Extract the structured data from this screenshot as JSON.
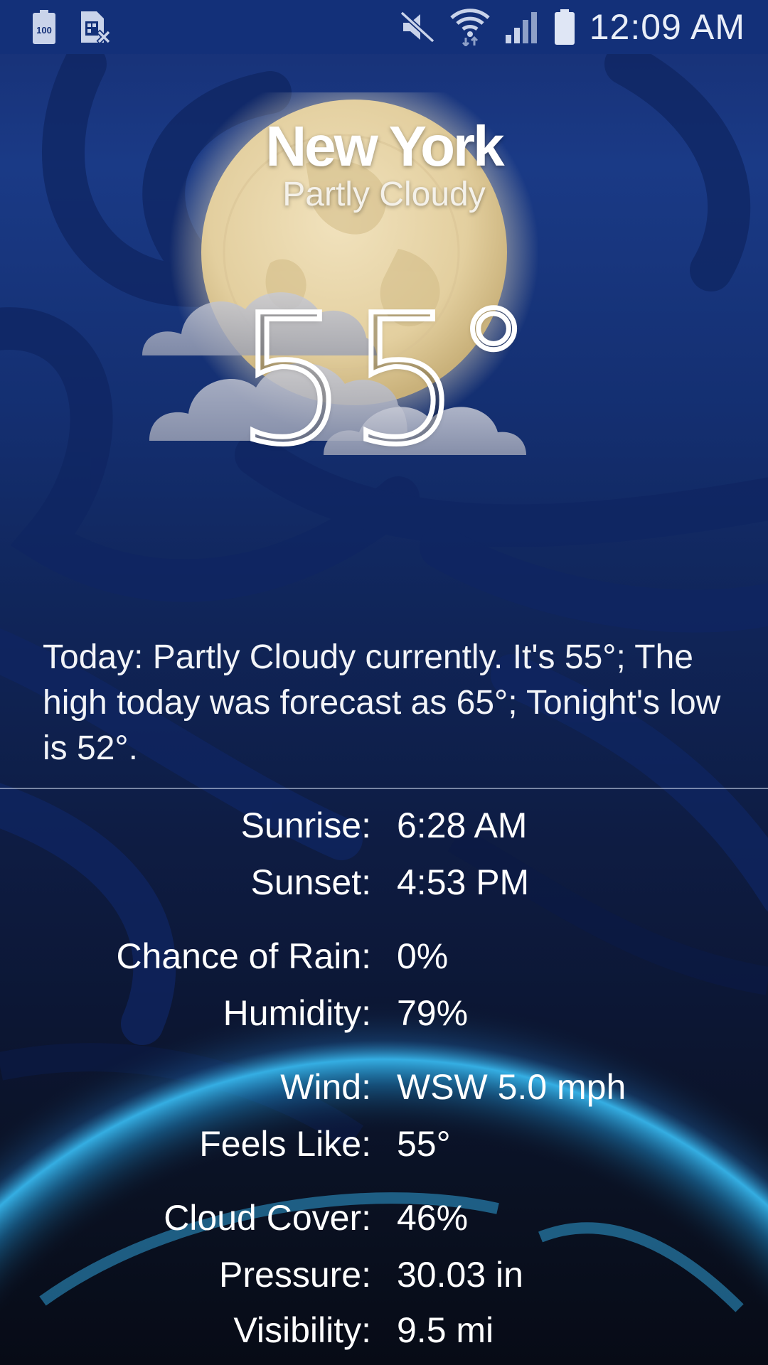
{
  "status_bar": {
    "battery_saver_icon_text": "100",
    "time": "12:09 AM",
    "icons": [
      "battery-100-icon",
      "no-sim-icon",
      "mute-icon",
      "wifi-icon",
      "signal-icon",
      "battery-icon"
    ]
  },
  "location": {
    "city": "New York",
    "condition": "Partly Cloudy"
  },
  "temperature": {
    "value": "55",
    "degree": "°"
  },
  "summary": "Today: Partly Cloudy currently. It's 55°; The high today was forecast as 65°; Tonight's low is 52°.",
  "details": [
    {
      "label": "Sunrise:",
      "value": "6:28 AM"
    },
    {
      "label": "Sunset:",
      "value": "4:53 PM"
    },
    {
      "label": "Chance of Rain:",
      "value": "0%"
    },
    {
      "label": "Humidity:",
      "value": "79%"
    },
    {
      "label": "Wind:",
      "value": "WSW 5.0 mph"
    },
    {
      "label": "Feels Like:",
      "value": "55°"
    },
    {
      "label": "Cloud Cover:",
      "value": "46%"
    },
    {
      "label": "Pressure:",
      "value": "30.03 in"
    },
    {
      "label": "Visibility:",
      "value": "9.5 mi"
    }
  ],
  "colors": {
    "background_top": "#1a3a86",
    "background_bottom": "#070b16",
    "status_bar": "#133079",
    "moon": "#e8d6ad",
    "earth_glow": "#2aa9e0"
  }
}
